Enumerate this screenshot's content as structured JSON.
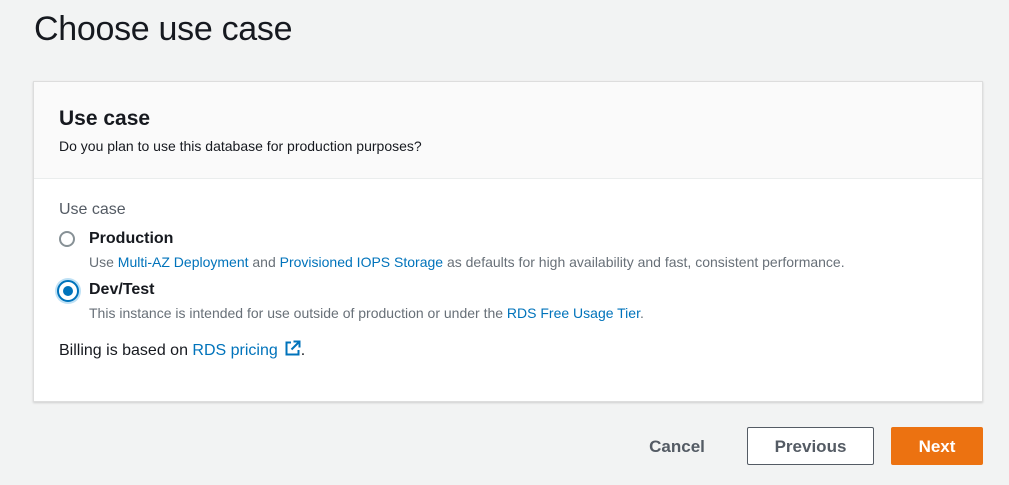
{
  "page": {
    "title": "Choose use case"
  },
  "panel": {
    "header_title": "Use case",
    "header_description": "Do you plan to use this database for production purposes?",
    "field_label": "Use case",
    "options": [
      {
        "title": "Production",
        "selected": false,
        "desc_prefix": "Use ",
        "link1": "Multi-AZ Deployment",
        "desc_middle": " and ",
        "link2": "Provisioned IOPS Storage",
        "desc_suffix": " as defaults for high availability and fast, consistent performance."
      },
      {
        "title": "Dev/Test",
        "selected": true,
        "desc_prefix": "This instance is intended for use outside of production or under the ",
        "link1": "RDS Free Usage Tier",
        "desc_suffix": "."
      }
    ],
    "billing_prefix": "Billing is based on ",
    "billing_link": "RDS pricing",
    "billing_suffix": "."
  },
  "actions": {
    "cancel_label": "Cancel",
    "previous_label": "Previous",
    "next_label": "Next"
  },
  "colors": {
    "accent": "#0073bb",
    "primary_button": "#ec7211",
    "background": "#f2f3f3"
  },
  "icons": {
    "external_link": "external-link-icon"
  }
}
